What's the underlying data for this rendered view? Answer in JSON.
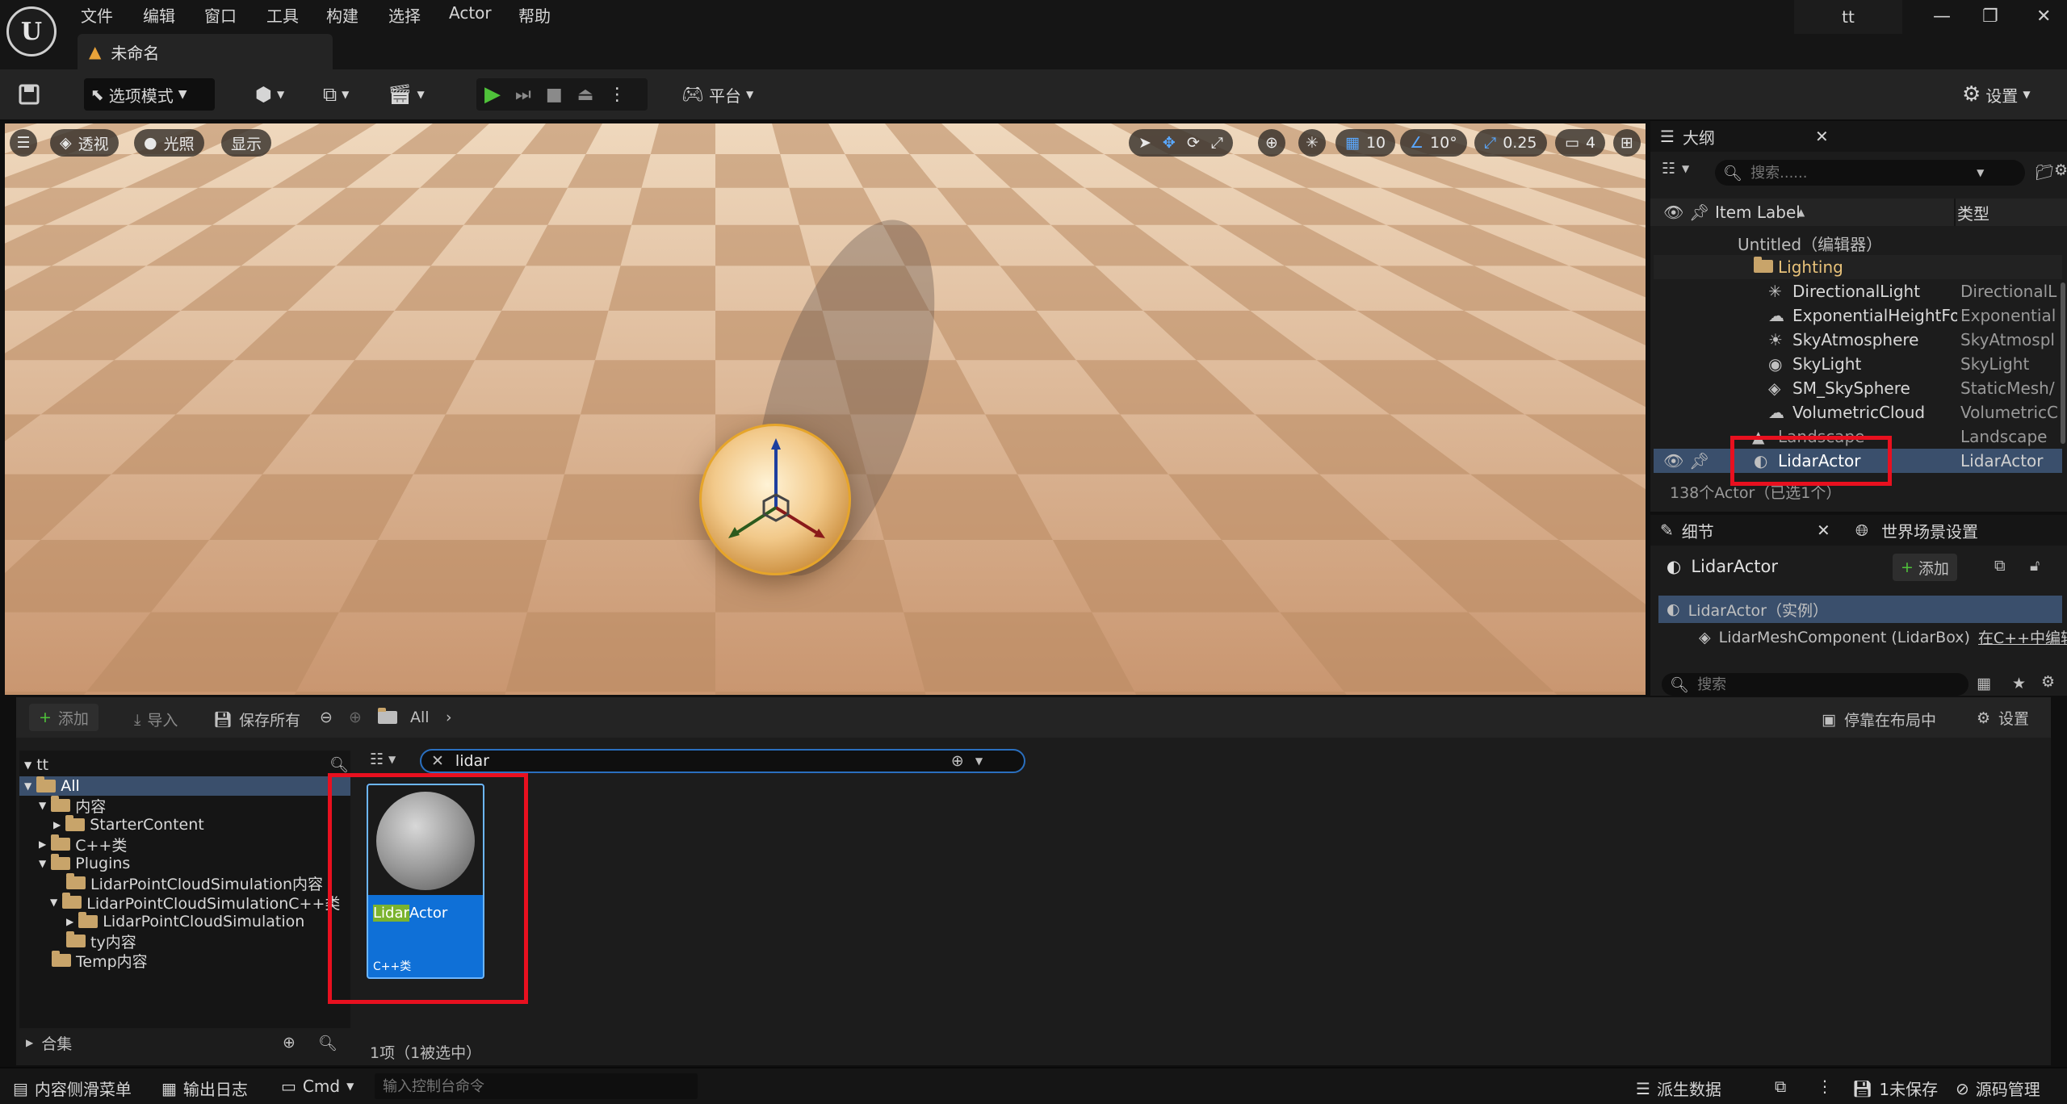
{
  "menu": {
    "items": [
      "文件",
      "编辑",
      "窗口",
      "工具",
      "构建",
      "选择",
      "Actor",
      "帮助"
    ],
    "project": "tt"
  },
  "tab": {
    "title": "未命名"
  },
  "toolbar": {
    "mode": "选项模式",
    "platform": "平台",
    "settings": "设置"
  },
  "viewport": {
    "perspective": "透视",
    "lit": "光照",
    "show": "显示",
    "grid_snap": "10",
    "rot_snap": "10°",
    "scale_snap": "0.25",
    "cam_speed": "4"
  },
  "outliner": {
    "title": "大纲",
    "search_placeholder": "搜索......",
    "col_label": "Item Label",
    "col_type": "类型",
    "rows": [
      {
        "label": "Untitled（编辑器）",
        "type": ""
      },
      {
        "label": "Lighting",
        "type": ""
      },
      {
        "label": "DirectionalLight",
        "type": "DirectionalL"
      },
      {
        "label": "ExponentialHeightFog",
        "type": "Exponentiall"
      },
      {
        "label": "SkyAtmosphere",
        "type": "SkyAtmospl"
      },
      {
        "label": "SkyLight",
        "type": "SkyLight"
      },
      {
        "label": "SM_SkySphere",
        "type": "StaticMesh/"
      },
      {
        "label": "VolumetricCloud",
        "type": "VolumetricC"
      },
      {
        "label": "Landscape",
        "type": "Landscape"
      },
      {
        "label": "LidarActor",
        "type": "LidarActor"
      }
    ],
    "count": "138个Actor（已选1个）"
  },
  "details": {
    "tab": "细节",
    "tab2": "世界场景设置",
    "actor": "LidarActor",
    "add": "添加",
    "instance": "LidarActor（实例）",
    "component": "LidarMeshComponent (LidarBox)",
    "component_link": "在C++中编辑",
    "search_placeholder": "搜索"
  },
  "content_browser": {
    "add": "添加",
    "import": "导入",
    "save_all": "保存所有",
    "path": "All",
    "dock": "停靠在布局中",
    "settings": "设置",
    "tree_root": "tt",
    "tree": [
      "All",
      "内容",
      "StarterContent",
      "C++类",
      "Plugins",
      "LidarPointCloudSimulation内容",
      "LidarPointCloudSimulationC++类",
      "LidarPointCloudSimulation",
      "ty内容",
      "Temp内容"
    ],
    "collections": "合集",
    "search_value": "lidar",
    "asset_name_highlight": "Lidar",
    "asset_name_rest": "Actor",
    "asset_type": "C++类",
    "item_count": "1项（1被选中）"
  },
  "status": {
    "drawer": "内容侧滑菜单",
    "output": "输出日志",
    "cmd": "Cmd",
    "cmd_placeholder": "输入控制台命令",
    "derived": "派生数据",
    "unsaved": "1未保存",
    "source": "源码管理"
  }
}
